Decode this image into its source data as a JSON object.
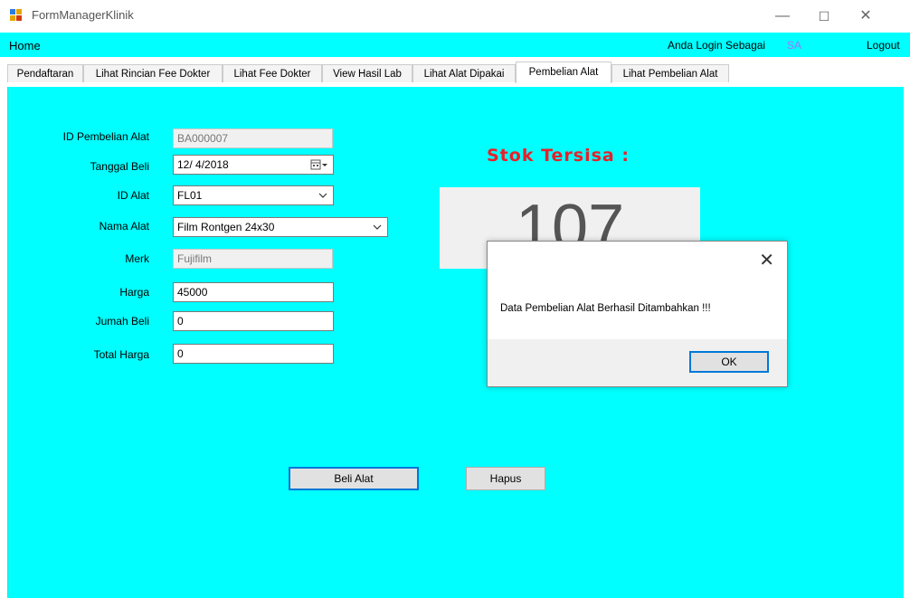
{
  "window": {
    "title": "FormManagerKlinik",
    "controls": {
      "minimize": "—",
      "maximize": "☐",
      "close": "✕"
    }
  },
  "menu": {
    "home": "Home",
    "login_label": "Anda Login Sebagai",
    "login_user": "SA",
    "logout": "Logout",
    "user_color": "#9a76ff"
  },
  "tabs": [
    {
      "label": "Pendaftaran"
    },
    {
      "label": "Lihat Rincian Fee Dokter"
    },
    {
      "label": "Lihat Fee Dokter"
    },
    {
      "label": "View Hasil Lab"
    },
    {
      "label": "Lihat Alat Dipakai"
    },
    {
      "label": "Pembelian Alat",
      "active": true
    },
    {
      "label": "Lihat Pembelian Alat"
    }
  ],
  "form": {
    "id_pembelian": {
      "label": "ID Pembelian Alat",
      "value": "BA000007"
    },
    "tanggal_beli": {
      "label": "Tanggal Beli",
      "value": "12/ 4/2018"
    },
    "id_alat": {
      "label": "ID Alat",
      "value": "FL01"
    },
    "nama_alat": {
      "label": "Nama Alat",
      "value": "Film Rontgen 24x30"
    },
    "merk": {
      "label": "Merk",
      "value": "Fujifilm"
    },
    "harga": {
      "label": "Harga",
      "value": "45000"
    },
    "jumlah_beli": {
      "label": "Jumah Beli",
      "value": "0"
    },
    "total_harga": {
      "label": "Total Harga",
      "value": "0"
    }
  },
  "stok": {
    "title": "Stok Tersisa :",
    "value": "107",
    "title_color": "#e8202a"
  },
  "buttons": {
    "beli": "Beli Alat",
    "hapus": "Hapus"
  },
  "dialog": {
    "message": "Data Pembelian Alat Berhasil Ditambahkan !!!",
    "ok": "OK",
    "close": "✕"
  },
  "colors": {
    "panel_bg": "#00ffff",
    "focus_border": "#0078d7"
  }
}
